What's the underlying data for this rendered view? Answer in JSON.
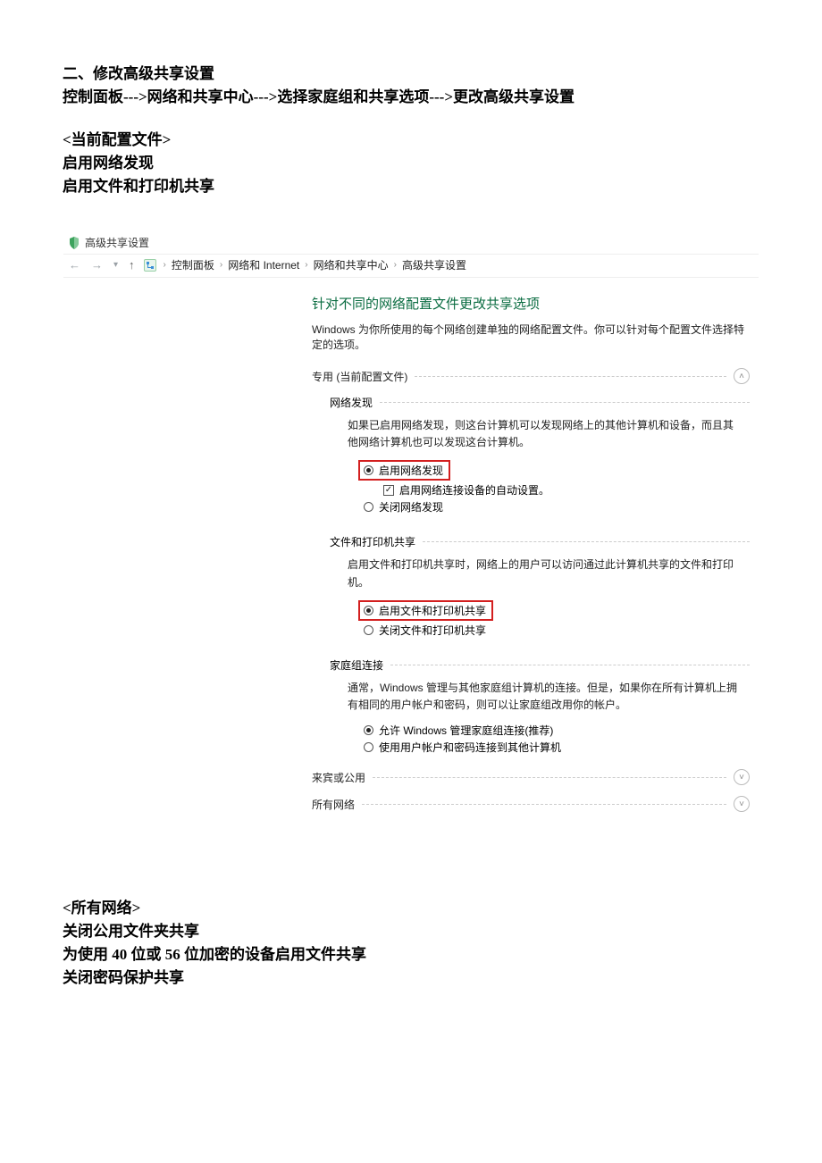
{
  "doc": {
    "h1": "二、修改高级共享设置",
    "path": "控制面板--->网络和共享中心--->选择家庭组和共享选项--->更改高级共享设置",
    "curProfile": "<当前配置文件>",
    "enableDiscovery": "启用网络发现",
    "enableFilePrint": "启用文件和打印机共享",
    "allNet": "<所有网络>",
    "closePublic": "关闭公用文件夹共享",
    "encryptLine": "为使用 40 位或 56 位加密的设备启用文件共享",
    "closePassword": "关闭密码保护共享"
  },
  "screenshot": {
    "windowTitle": "高级共享设置",
    "crumbs": [
      "控制面板",
      "网络和 Internet",
      "网络和共享中心",
      "高级共享设置"
    ],
    "title": "针对不同的网络配置文件更改共享选项",
    "desc": "Windows 为你所使用的每个网络创建单独的网络配置文件。你可以针对每个配置文件选择特定的选项。",
    "profilePrivate": "专用 (当前配置文件)",
    "netDiscovery": {
      "label": "网络发现",
      "blurb": "如果已启用网络发现，则这台计算机可以发现网络上的其他计算机和设备，而且其他网络计算机也可以发现这台计算机。",
      "opt_on": "启用网络发现",
      "check": "启用网络连接设备的自动设置。",
      "opt_off": "关闭网络发现"
    },
    "filePrint": {
      "label": "文件和打印机共享",
      "blurb": "启用文件和打印机共享时，网络上的用户可以访问通过此计算机共享的文件和打印机。",
      "opt_on": "启用文件和打印机共享",
      "opt_off": "关闭文件和打印机共享"
    },
    "homegroup": {
      "label": "家庭组连接",
      "blurb": "通常，Windows 管理与其他家庭组计算机的连接。但是，如果你在所有计算机上拥有相同的用户帐户和密码，则可以让家庭组改用你的帐户。",
      "opt_allow": "允许 Windows 管理家庭组连接(推荐)",
      "opt_user": "使用用户帐户和密码连接到其他计算机"
    },
    "profileGuest": "来宾或公用",
    "profileAll": "所有网络"
  }
}
